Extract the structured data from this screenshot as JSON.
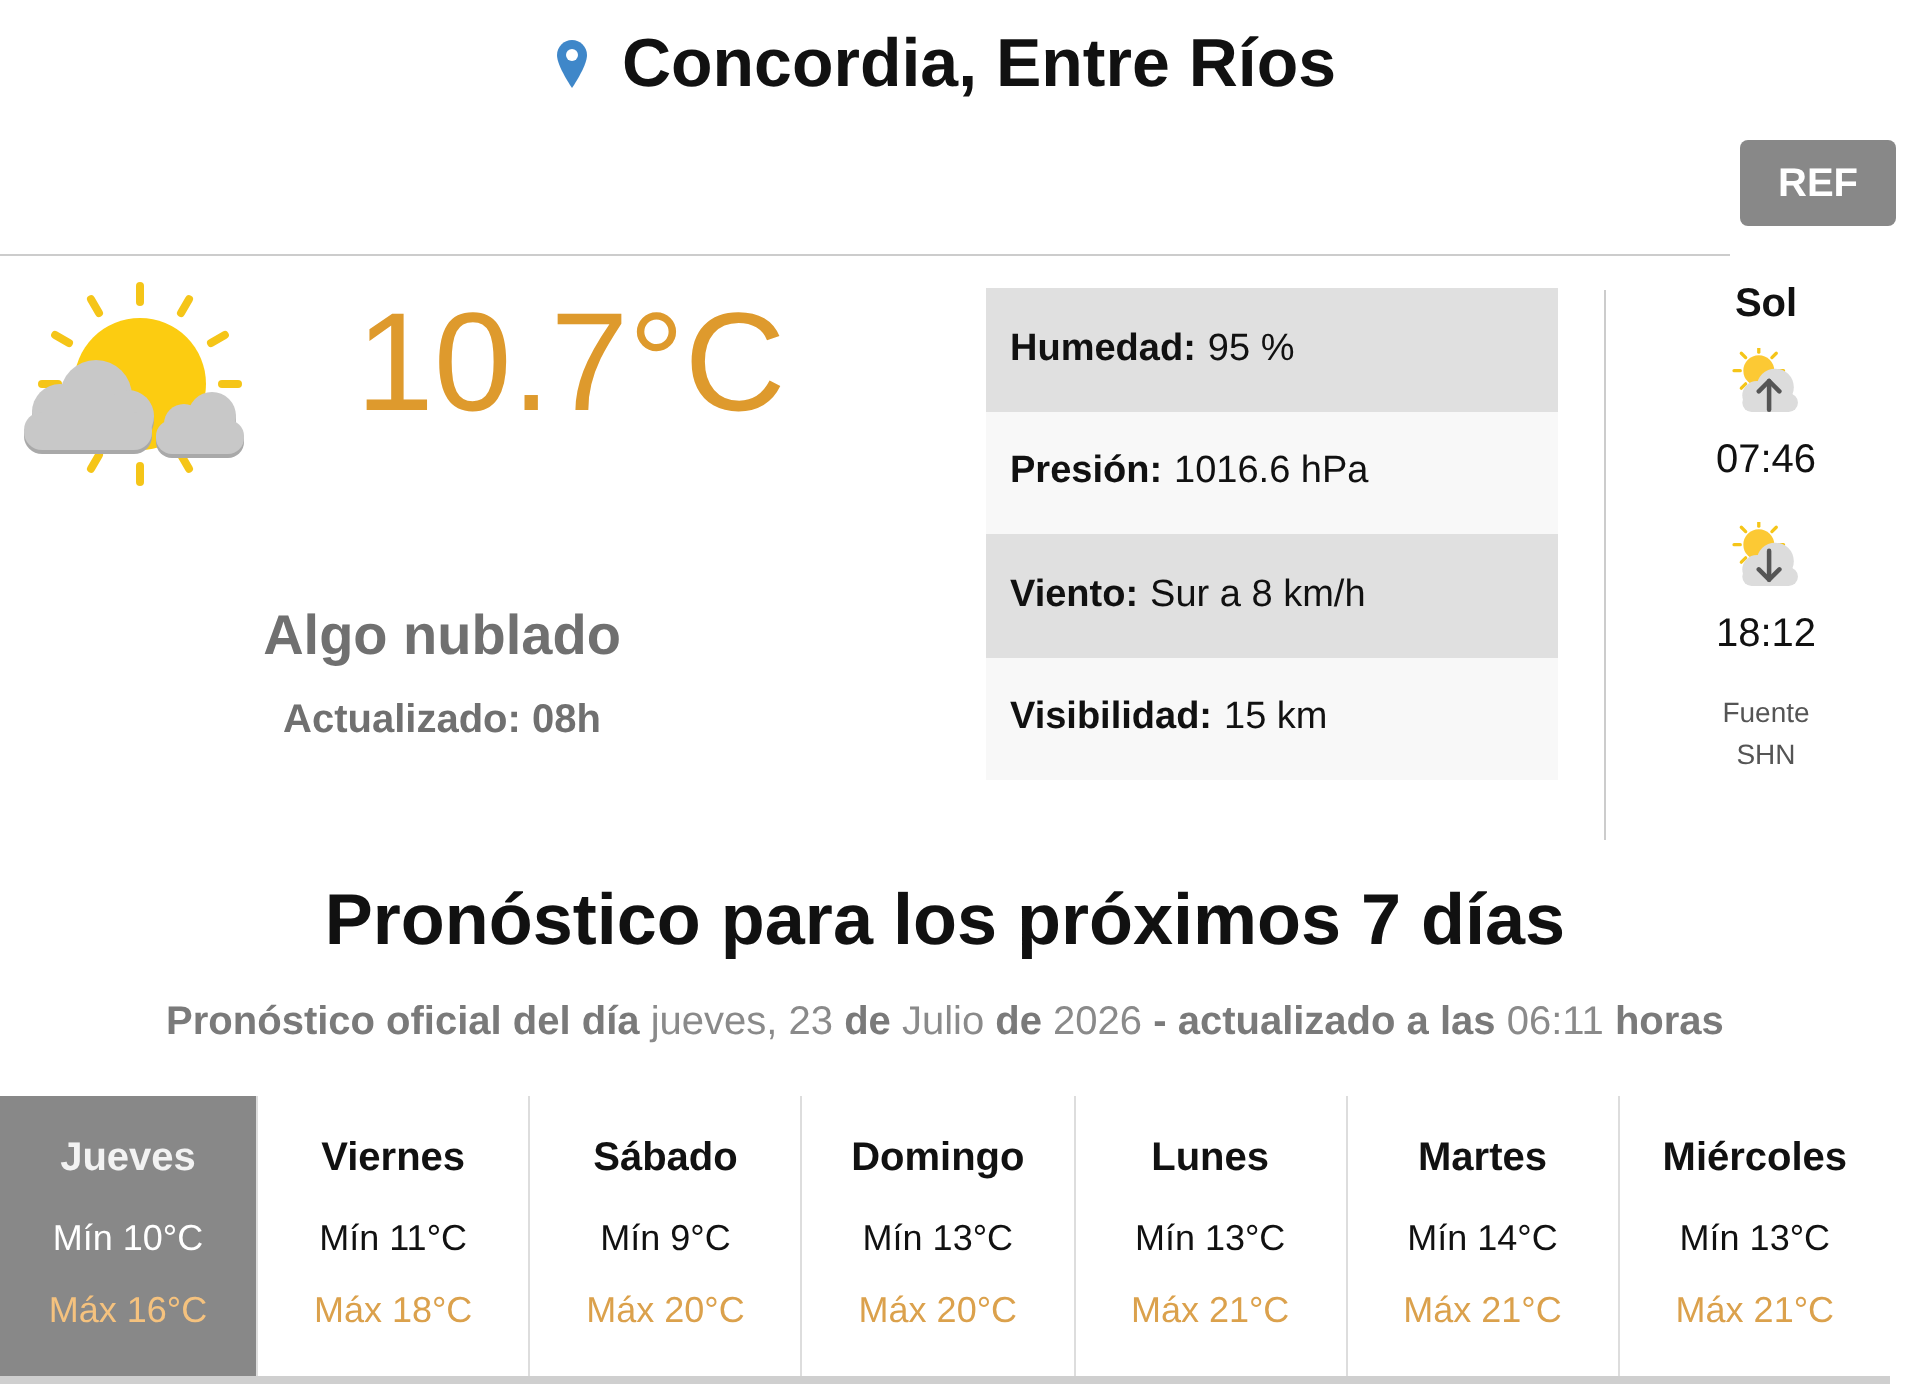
{
  "header": {
    "title": "Concordia, Entre Ríos"
  },
  "toolbar": {
    "button": "REF"
  },
  "current": {
    "temperature": "10.7°C",
    "condition": "Algo nublado",
    "updated": "Actualizado: 08h"
  },
  "details": [
    {
      "label": "Humedad:",
      "value": "95 %"
    },
    {
      "label": "Presión:",
      "value": "1016.6 hPa"
    },
    {
      "label": "Viento:",
      "value": "Sur a 8 km/h"
    },
    {
      "label": "Visibilidad:",
      "value": "15 km"
    }
  ],
  "sun": {
    "title": "Sol",
    "sunrise": "07:46",
    "sunset": "18:12",
    "source_label": "Fuente",
    "source": "SHN"
  },
  "forecast": {
    "title": "Pronóstico para los próximos 7 días",
    "subtitle": "**Pronóstico oficial del día** jueves, 23 **de** Julio **de** 2026 **- actualizado a las** 06:11 **horas**",
    "days": [
      {
        "name": "Jueves",
        "min": "Mín 10°C",
        "max": "Máx 16°C",
        "selected": true
      },
      {
        "name": "Viernes",
        "min": "Mín 11°C",
        "max": "Máx 18°C",
        "selected": false
      },
      {
        "name": "Sábado",
        "min": "Mín 9°C",
        "max": "Máx 20°C",
        "selected": false
      },
      {
        "name": "Domingo",
        "min": "Mín 13°C",
        "max": "Máx 20°C",
        "selected": false
      },
      {
        "name": "Lunes",
        "min": "Mín 13°C",
        "max": "Máx 21°C",
        "selected": false
      },
      {
        "name": "Martes",
        "min": "Mín 14°C",
        "max": "Máx 21°C",
        "selected": false
      },
      {
        "name": "Miércoles",
        "min": "Mín 13°C",
        "max": "Máx 21°C",
        "selected": false
      }
    ]
  }
}
